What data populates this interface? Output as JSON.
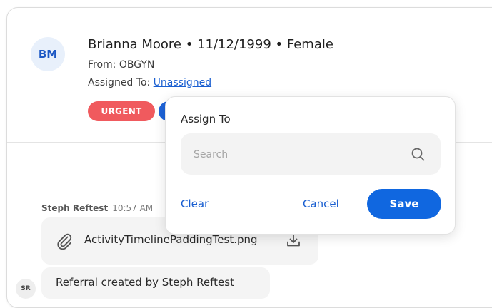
{
  "patient": {
    "initials": "BM",
    "name_line": "Brianna Moore • 11/12/1999 • Female",
    "from_label": "From: OBGYN",
    "assigned_prefix": "Assigned To: ",
    "assigned_value": "Unassigned",
    "badges": [
      {
        "label": "URGENT",
        "color": "#f05a5e"
      }
    ]
  },
  "timeline": {
    "message": {
      "author": "Steph Reftest",
      "time": "10:57 AM",
      "attachment_name": "ActivityTimelinePaddingTest.png"
    },
    "referral": {
      "avatar_initials": "SR",
      "text": "Referral created by  Steph Reftest"
    }
  },
  "assign_popover": {
    "title": "Assign To",
    "search_placeholder": "Search",
    "clear_label": "Clear",
    "cancel_label": "Cancel",
    "save_label": "Save"
  },
  "colors": {
    "accent": "#1067e0",
    "link": "#1a5fd1",
    "urgent": "#f05a5e"
  }
}
